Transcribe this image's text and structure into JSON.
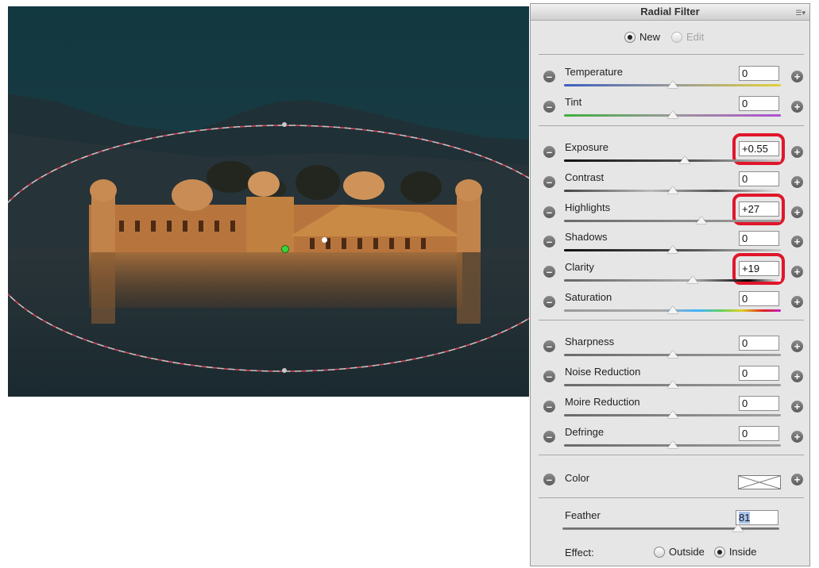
{
  "panel": {
    "title": "Radial Filter",
    "menu_icon": "panel-menu-icon",
    "mode": {
      "new_label": "New",
      "edit_label": "Edit",
      "selected": "New"
    }
  },
  "adjustments": [
    {
      "label": "Temperature",
      "value": "0",
      "level": 0.5,
      "track": "temperature",
      "highlighted": false
    },
    {
      "label": "Tint",
      "value": "0",
      "level": 0.5,
      "track": "tint",
      "highlighted": false
    },
    {
      "label": "Exposure",
      "value": "+0.55",
      "level": 0.555,
      "track": "dark-gray",
      "highlighted": true
    },
    {
      "label": "Contrast",
      "value": "0",
      "level": 0.5,
      "track": "contrast",
      "highlighted": false
    },
    {
      "label": "Highlights",
      "value": "+27",
      "level": 0.635,
      "track": "gray",
      "highlighted": true
    },
    {
      "label": "Shadows",
      "value": "0",
      "level": 0.5,
      "track": "dark-gray",
      "highlighted": false
    },
    {
      "label": "Clarity",
      "value": "+19",
      "level": 0.595,
      "track": "clarity",
      "highlighted": true
    },
    {
      "label": "Saturation",
      "value": "0",
      "level": 0.5,
      "track": "saturation",
      "highlighted": false
    },
    {
      "label": "Sharpness",
      "value": "0",
      "level": 0.5,
      "track": "gray",
      "highlighted": false
    },
    {
      "label": "Noise Reduction",
      "value": "0",
      "level": 0.5,
      "track": "gray",
      "highlighted": false
    },
    {
      "label": "Moire Reduction",
      "value": "0",
      "level": 0.5,
      "track": "gray",
      "highlighted": false
    },
    {
      "label": "Defringe",
      "value": "0",
      "level": 0.5,
      "track": "gray",
      "highlighted": false
    }
  ],
  "color": {
    "label": "Color",
    "swatch": "none"
  },
  "feather": {
    "label": "Feather",
    "value": "81",
    "level": 0.81
  },
  "effect": {
    "label": "Effect:",
    "outside_label": "Outside",
    "inside_label": "Inside",
    "selected": "Inside"
  },
  "colors": {
    "highlight_border": "#e0162b",
    "panel_bg": "#e6e6e6",
    "mask_outline": "#d04a5a",
    "pin_active": "#3cd33c"
  }
}
